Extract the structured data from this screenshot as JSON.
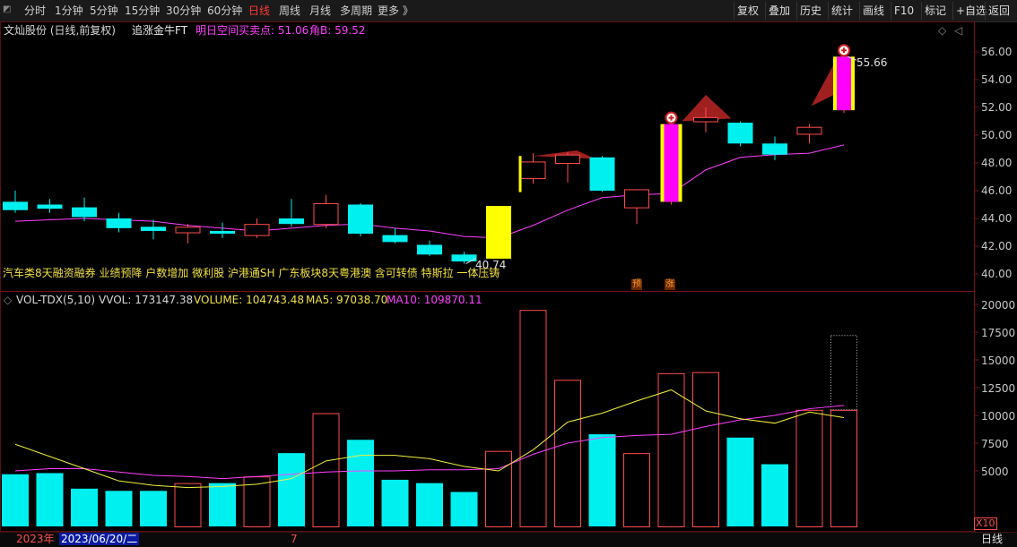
{
  "toolbar": {
    "periods": [
      "分时",
      "1分钟",
      "5分钟",
      "15分钟",
      "30分钟",
      "60分钟",
      "日线",
      "周线",
      "月线",
      "多周期",
      "更多 》"
    ],
    "active_index": 6,
    "right_buttons": [
      "复权",
      "叠加",
      "历史",
      "统计",
      "画线",
      "F10",
      "标记",
      "+自选",
      "返回"
    ]
  },
  "price_panel": {
    "stock_title": "文灿股份 (日线,前复权)",
    "indicator_name": "追涨金牛FT",
    "signal_text": "明日空间买卖点: 51.06",
    "angle_text": "角B: 59.52",
    "high_label": "55.66",
    "low_label": "40.74",
    "axis_ticks": [
      "56.00",
      "54.00",
      "52.00",
      "50.00",
      "48.00",
      "46.00",
      "44.00",
      "42.00",
      "40.00"
    ],
    "concept_tags": "汽车类8天融资融券  业绩预降  户数增加  微利股  沪港通SH  广东板块8天粤港澳  含可转债  特斯拉  一体压铸",
    "markers": [
      "预",
      "涨"
    ]
  },
  "volume_panel": {
    "indicator_name": "VOL-TDX(5,10)",
    "vvol": "VVOL: 173147.38",
    "volume": "VOLUME: 104743.48",
    "ma5": "MA5: 97038.70",
    "ma10": "MA10: 109870.11",
    "axis_ticks": [
      "20000",
      "17500",
      "15000",
      "12500",
      "10000",
      "7500",
      "5000"
    ],
    "unit": "X10"
  },
  "bottom": {
    "year": "2023年",
    "date": "2023/06/20/二",
    "month_mark": "7",
    "period": "日线"
  },
  "colors": {
    "up": "#ff4d4d",
    "down": "#00f0f0",
    "ma5": "#f0f040",
    "ma10": "#ff40ff",
    "signal_yellow": "#ffff00",
    "signal_magenta": "#ff00ff",
    "wing": "#a02020"
  },
  "chart_data": {
    "type": "candlestick",
    "dates_visible": [
      "2023年",
      "2023/06/20/二",
      "7"
    ],
    "candles": [
      {
        "o": 45.2,
        "h": 46.0,
        "l": 44.4,
        "c": 44.6,
        "vol": 4700
      },
      {
        "o": 45.0,
        "h": 45.4,
        "l": 44.4,
        "c": 44.7,
        "vol": 4800
      },
      {
        "o": 44.8,
        "h": 45.5,
        "l": 43.8,
        "c": 44.1,
        "vol": 3400
      },
      {
        "o": 44.0,
        "h": 44.4,
        "l": 43.0,
        "c": 43.3,
        "vol": 3200
      },
      {
        "o": 43.4,
        "h": 43.9,
        "l": 42.5,
        "c": 43.1,
        "vol": 3200
      },
      {
        "o": 43.0,
        "h": 43.6,
        "l": 42.2,
        "c": 43.4,
        "vol": 3900
      },
      {
        "o": 43.1,
        "h": 43.7,
        "l": 42.6,
        "c": 42.9,
        "vol": 3900
      },
      {
        "o": 42.8,
        "h": 44.0,
        "l": 42.6,
        "c": 43.6,
        "vol": 4500
      },
      {
        "o": 44.0,
        "h": 45.4,
        "l": 43.4,
        "c": 43.6,
        "vol": 6600
      },
      {
        "o": 43.6,
        "h": 45.7,
        "l": 43.3,
        "c": 45.1,
        "vol": 10200
      },
      {
        "o": 45.0,
        "h": 45.1,
        "l": 42.7,
        "c": 42.9,
        "vol": 7800
      },
      {
        "o": 42.8,
        "h": 43.3,
        "l": 42.2,
        "c": 42.3,
        "vol": 4200
      },
      {
        "o": 42.1,
        "h": 42.4,
        "l": 41.3,
        "c": 41.4,
        "vol": 3900
      },
      {
        "o": 41.4,
        "h": 41.6,
        "l": 40.74,
        "c": 40.9,
        "vol": 3100
      },
      {
        "o": 41.1,
        "h": 45.0,
        "l": 41.0,
        "c": 44.9,
        "vol": 6800,
        "signal": "yellow"
      },
      {
        "o": 46.9,
        "h": 48.7,
        "l": 46.5,
        "c": 48.1,
        "vol": 19500
      },
      {
        "o": 48.0,
        "h": 48.8,
        "l": 46.6,
        "c": 48.6,
        "vol": 13200
      },
      {
        "o": 48.4,
        "h": 48.5,
        "l": 45.9,
        "c": 46.0,
        "vol": 8300
      },
      {
        "o": 44.8,
        "h": 46.1,
        "l": 43.6,
        "c": 46.1,
        "vol": 6600
      },
      {
        "o": 45.2,
        "h": 50.8,
        "l": 45.0,
        "c": 50.8,
        "vol": 13800,
        "signal": "magenta"
      },
      {
        "o": 51.0,
        "h": 52.0,
        "l": 50.2,
        "c": 51.3,
        "vol": 13900
      },
      {
        "o": 50.9,
        "h": 51.0,
        "l": 49.2,
        "c": 49.4,
        "vol": 8000
      },
      {
        "o": 49.4,
        "h": 49.9,
        "l": 48.2,
        "c": 48.6,
        "vol": 5600
      },
      {
        "o": 50.1,
        "h": 50.8,
        "l": 49.4,
        "c": 50.6,
        "vol": 10500
      },
      {
        "o": 51.8,
        "h": 55.66,
        "l": 51.6,
        "c": 55.66,
        "vol": 10500,
        "vol_estimate": 17200,
        "signal": "magenta"
      }
    ],
    "ma_price": [
      43.8,
      43.9,
      44.0,
      43.9,
      43.8,
      43.5,
      43.3,
      43.1,
      43.3,
      43.5,
      43.6,
      43.3,
      43.1,
      42.7,
      42.6,
      43.5,
      44.6,
      45.5,
      45.7,
      45.8,
      47.5,
      48.4,
      48.6,
      48.7,
      49.3
    ],
    "ma5_vol": [
      7400,
      6300,
      5200,
      4100,
      3700,
      3500,
      3600,
      3800,
      4300,
      5900,
      6400,
      6400,
      6100,
      5400,
      5000,
      6900,
      9400,
      10200,
      11300,
      12300,
      10400,
      9700,
      9300,
      10300,
      9800
    ],
    "ma10_vol": [
      5000,
      5200,
      5200,
      4900,
      4600,
      4500,
      4300,
      4500,
      4700,
      4900,
      5000,
      5000,
      5100,
      5100,
      5200,
      6500,
      7500,
      8000,
      8200,
      8300,
      9000,
      9600,
      10000,
      10600,
      10900
    ],
    "price_ylim": [
      39.5,
      57.0
    ],
    "vol_ylim": [
      0,
      20500
    ]
  }
}
